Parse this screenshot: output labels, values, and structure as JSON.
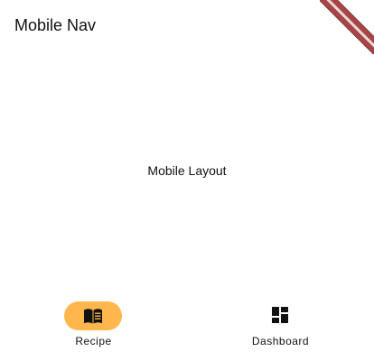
{
  "app_bar": {
    "title": "Mobile Nav"
  },
  "body": {
    "text": "Mobile Layout"
  },
  "bottom_nav": {
    "items": [
      {
        "label": "Recipe",
        "icon": "menu-book-icon",
        "selected": true
      },
      {
        "label": "Dashboard",
        "icon": "dashboard-icon",
        "selected": false
      }
    ],
    "indicator_color": "#ffb74d"
  },
  "debug_banner": {
    "color": "#a34747"
  }
}
